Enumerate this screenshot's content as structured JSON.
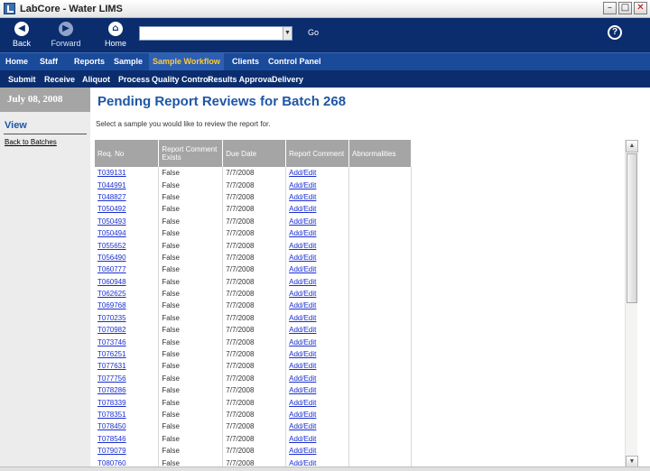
{
  "window": {
    "title": "LabCore - Water LIMS"
  },
  "toolbar": {
    "back_label": "Back",
    "forward_label": "Forward",
    "home_label": "Home",
    "url_value": "",
    "go_label": "Go",
    "help_symbol": "?"
  },
  "main_nav": [
    "Home",
    "Staff",
    "Reports",
    "Sample",
    "Sample Workflow",
    "Clients",
    "Control Panel"
  ],
  "main_nav_active": "Sample Workflow",
  "sub_nav": [
    "Submit",
    "Receive",
    "Aliquot",
    "Process",
    "Quality Control",
    "Results Approval",
    "Delivery"
  ],
  "sidebar": {
    "date": "July 08, 2008",
    "view_title": "View",
    "back_link": "Back to Batches"
  },
  "page": {
    "title": "Pending Report Reviews for Batch 268",
    "instructions": "Select a sample you would like to review the report for."
  },
  "table": {
    "headers": [
      "Req. No",
      "Report Comment Exists",
      "Due Date",
      "Report Comment",
      "Abnormalities"
    ],
    "rows": [
      {
        "req": "T039131",
        "exists": "False",
        "due": "7/7/2008",
        "comment": "Add/Edit"
      },
      {
        "req": "T044991",
        "exists": "False",
        "due": "7/7/2008",
        "comment": "Add/Edit"
      },
      {
        "req": "T048827",
        "exists": "False",
        "due": "7/7/2008",
        "comment": "Add/Edit"
      },
      {
        "req": "T050492",
        "exists": "False",
        "due": "7/7/2008",
        "comment": "Add/Edit"
      },
      {
        "req": "T050493",
        "exists": "False",
        "due": "7/7/2008",
        "comment": "Add/Edit"
      },
      {
        "req": "T050494",
        "exists": "False",
        "due": "7/7/2008",
        "comment": "Add/Edit"
      },
      {
        "req": "T055652",
        "exists": "False",
        "due": "7/7/2008",
        "comment": "Add/Edit"
      },
      {
        "req": "T056490",
        "exists": "False",
        "due": "7/7/2008",
        "comment": "Add/Edit"
      },
      {
        "req": "T060777",
        "exists": "False",
        "due": "7/7/2008",
        "comment": "Add/Edit"
      },
      {
        "req": "T060948",
        "exists": "False",
        "due": "7/7/2008",
        "comment": "Add/Edit"
      },
      {
        "req": "T062625",
        "exists": "False",
        "due": "7/7/2008",
        "comment": "Add/Edit"
      },
      {
        "req": "T069768",
        "exists": "False",
        "due": "7/7/2008",
        "comment": "Add/Edit"
      },
      {
        "req": "T070235",
        "exists": "False",
        "due": "7/7/2008",
        "comment": "Add/Edit"
      },
      {
        "req": "T070982",
        "exists": "False",
        "due": "7/7/2008",
        "comment": "Add/Edit"
      },
      {
        "req": "T073746",
        "exists": "False",
        "due": "7/7/2008",
        "comment": "Add/Edit"
      },
      {
        "req": "T076251",
        "exists": "False",
        "due": "7/7/2008",
        "comment": "Add/Edit"
      },
      {
        "req": "T077631",
        "exists": "False",
        "due": "7/7/2008",
        "comment": "Add/Edit"
      },
      {
        "req": "T077756",
        "exists": "False",
        "due": "7/7/2008",
        "comment": "Add/Edit"
      },
      {
        "req": "T078286",
        "exists": "False",
        "due": "7/7/2008",
        "comment": "Add/Edit"
      },
      {
        "req": "T078339",
        "exists": "False",
        "due": "7/7/2008",
        "comment": "Add/Edit"
      },
      {
        "req": "T078351",
        "exists": "False",
        "due": "7/7/2008",
        "comment": "Add/Edit"
      },
      {
        "req": "T078450",
        "exists": "False",
        "due": "7/7/2008",
        "comment": "Add/Edit"
      },
      {
        "req": "T078546",
        "exists": "False",
        "due": "7/7/2008",
        "comment": "Add/Edit"
      },
      {
        "req": "T079079",
        "exists": "False",
        "due": "7/7/2008",
        "comment": "Add/Edit"
      },
      {
        "req": "T080760",
        "exists": "False",
        "due": "7/7/2008",
        "comment": "Add/Edit"
      }
    ]
  },
  "colors": {
    "toolbar_bg": "#0b2d6e",
    "nav_bg": "#1a4a9a",
    "active_nav_text": "#ffcc33",
    "title_blue": "#1f56a5",
    "header_gray": "#a5a5a5",
    "link_blue": "#1a2fd0"
  }
}
